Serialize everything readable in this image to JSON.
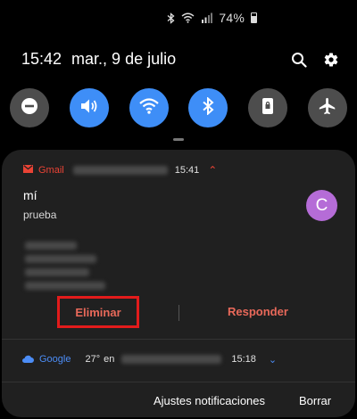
{
  "status_bar": {
    "battery_percent": "74%",
    "icons": [
      "bluetooth-icon",
      "wifi-icon",
      "signal-icon",
      "battery-icon"
    ]
  },
  "header": {
    "time": "15:42",
    "date": "mar., 9 de julio",
    "actions": [
      "search-icon",
      "settings-gear-icon"
    ]
  },
  "quick_settings": [
    {
      "name": "do-not-disturb",
      "icon": "minus-circle-icon",
      "on": false
    },
    {
      "name": "sound",
      "icon": "speaker-icon",
      "on": true
    },
    {
      "name": "wifi",
      "icon": "wifi-icon",
      "on": true
    },
    {
      "name": "bluetooth",
      "icon": "bluetooth-icon",
      "on": true
    },
    {
      "name": "screen-lock",
      "icon": "lock-icon",
      "on": false
    },
    {
      "name": "airplane",
      "icon": "airplane-icon",
      "on": false
    }
  ],
  "notifications": {
    "gmail": {
      "app": "Gmail",
      "time": "15:41",
      "title": "mí",
      "body": "prueba",
      "avatar_letter": "C",
      "actions": {
        "delete": "Eliminar",
        "reply": "Responder"
      }
    },
    "google": {
      "app": "Google",
      "temp": "27°",
      "connector": "en",
      "time": "15:18"
    }
  },
  "footer": {
    "settings": "Ajustes notificaciones",
    "clear": "Borrar"
  },
  "colors": {
    "accent_blue": "#3e8ef7",
    "gmail_red": "#ea4335",
    "action_red": "#e9695a",
    "highlight_red": "#e21b1b",
    "panel_bg": "#202020",
    "avatar_purple": "#b56cd7"
  }
}
